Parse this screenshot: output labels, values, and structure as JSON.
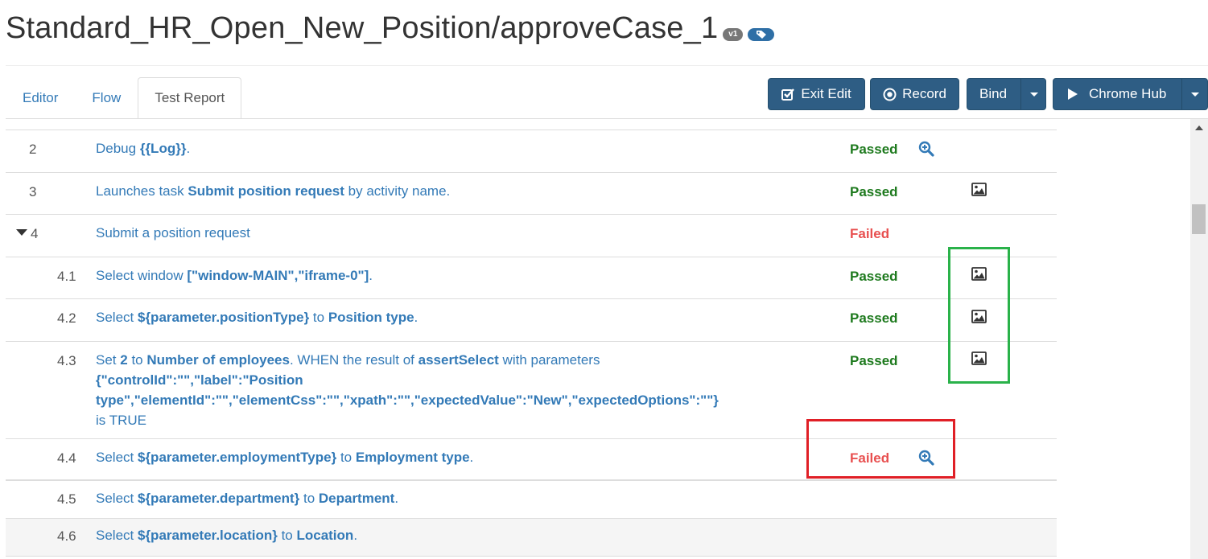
{
  "header": {
    "title": "Standard_HR_Open_New_Position/approveCase_1",
    "version_badge": "v1",
    "tag_icon": "tag-icon"
  },
  "tabs": [
    {
      "label": "Editor",
      "active": false
    },
    {
      "label": "Flow",
      "active": false
    },
    {
      "label": "Test Report",
      "active": true
    }
  ],
  "toolbar": {
    "exit_edit": "Exit Edit",
    "record": "Record",
    "bind": "Bind",
    "chrome_hub": "Chrome Hub"
  },
  "colors": {
    "button_bg": "#2e5d84",
    "link": "#337ab7",
    "passed": "#1e7a1e",
    "failed": "#e85050",
    "highlight_green": "#2ab24a",
    "highlight_red": "#e01f26"
  },
  "steps": [
    {
      "num": "2",
      "parts": [
        [
          "Debug ",
          false
        ],
        [
          "{{Log}}",
          true
        ],
        [
          ".",
          false
        ]
      ],
      "status": "Passed",
      "icon": "zoom-icon"
    },
    {
      "num": "3",
      "parts": [
        [
          "Launches task ",
          false
        ],
        [
          "Submit position request",
          true
        ],
        [
          " by activity name.",
          false
        ]
      ],
      "status": "Passed",
      "icon": "image-icon"
    },
    {
      "num": "4",
      "parts": [
        [
          "Submit a position request",
          false
        ]
      ],
      "status": "Failed",
      "icon": "",
      "expanded": true
    },
    {
      "num": "4.1",
      "parts": [
        [
          "Select window ",
          false
        ],
        [
          "[\"window-MAIN\",\"iframe-0\"]",
          true
        ],
        [
          ".",
          false
        ]
      ],
      "status": "Passed",
      "icon": "image-icon"
    },
    {
      "num": "4.2",
      "parts": [
        [
          "Select ",
          false
        ],
        [
          "${parameter.positionType}",
          true
        ],
        [
          " to ",
          false
        ],
        [
          "Position type",
          true
        ],
        [
          ".",
          false
        ]
      ],
      "status": "Passed",
      "icon": "image-icon"
    },
    {
      "num": "4.3",
      "lines": [
        [
          [
            "Set ",
            false
          ],
          [
            "2",
            true
          ],
          [
            " to ",
            false
          ],
          [
            "Number of employees",
            true
          ],
          [
            ". WHEN the result of ",
            false
          ],
          [
            "assertSelect",
            true
          ],
          [
            " with parameters",
            false
          ]
        ],
        [
          [
            "{\"controlId\":\"\",\"label\":\"Position",
            true
          ]
        ],
        [
          [
            "type\",\"elementId\":\"\",\"elementCss\":\"\",\"xpath\":\"\",\"expectedValue\":\"New\",\"expectedOptions\":\"\"}",
            true
          ]
        ],
        [
          [
            "is TRUE",
            false
          ]
        ]
      ],
      "status": "Passed",
      "icon": "image-icon"
    },
    {
      "num": "4.4",
      "parts": [
        [
          "Select ",
          false
        ],
        [
          "${parameter.employmentType}",
          true
        ],
        [
          " to ",
          false
        ],
        [
          "Employment type",
          true
        ],
        [
          ".",
          false
        ]
      ],
      "status": "Failed",
      "icon": "zoom-icon"
    },
    {
      "num": "4.5",
      "parts": [
        [
          "Select ",
          false
        ],
        [
          "${parameter.department}",
          true
        ],
        [
          " to ",
          false
        ],
        [
          "Department",
          true
        ],
        [
          ".",
          false
        ]
      ],
      "status": "",
      "icon": ""
    },
    {
      "num": "4.6",
      "parts": [
        [
          "Select ",
          false
        ],
        [
          "${parameter.location}",
          true
        ],
        [
          " to ",
          false
        ],
        [
          "Location",
          true
        ],
        [
          ".",
          false
        ]
      ],
      "status": "",
      "icon": ""
    }
  ]
}
